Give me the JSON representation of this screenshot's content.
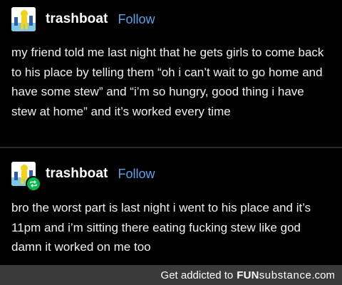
{
  "posts": [
    {
      "username": "trashboat",
      "follow_label": "Follow",
      "avatar_icon": "avatar-icon",
      "reblogged": false,
      "body": "my friend told me last night that he gets girls to come back to his place by telling them “oh i can’t wait to go home and have some stew” and “i’m so hungry, good thing i have stew at home” and it’s worked every time"
    },
    {
      "username": "trashboat",
      "follow_label": "Follow",
      "avatar_icon": "avatar-icon",
      "reblogged": true,
      "reblog_icon": "reblog-icon",
      "body": "bro the worst part is last night i went to his place and it’s 11pm and i’m sitting there eating fucking stew like god damn it worked on me too"
    }
  ],
  "footer": {
    "prefix": "Get addicted to",
    "brand_bold": "FUN",
    "brand_rest": "substance",
    "brand_suffix": ".com"
  },
  "colors": {
    "background": "#000000",
    "text": "#f0f0f0",
    "follow": "#5aa4e8",
    "reblog_badge": "#00b84a",
    "footer_bar": "#3a3a3a"
  }
}
